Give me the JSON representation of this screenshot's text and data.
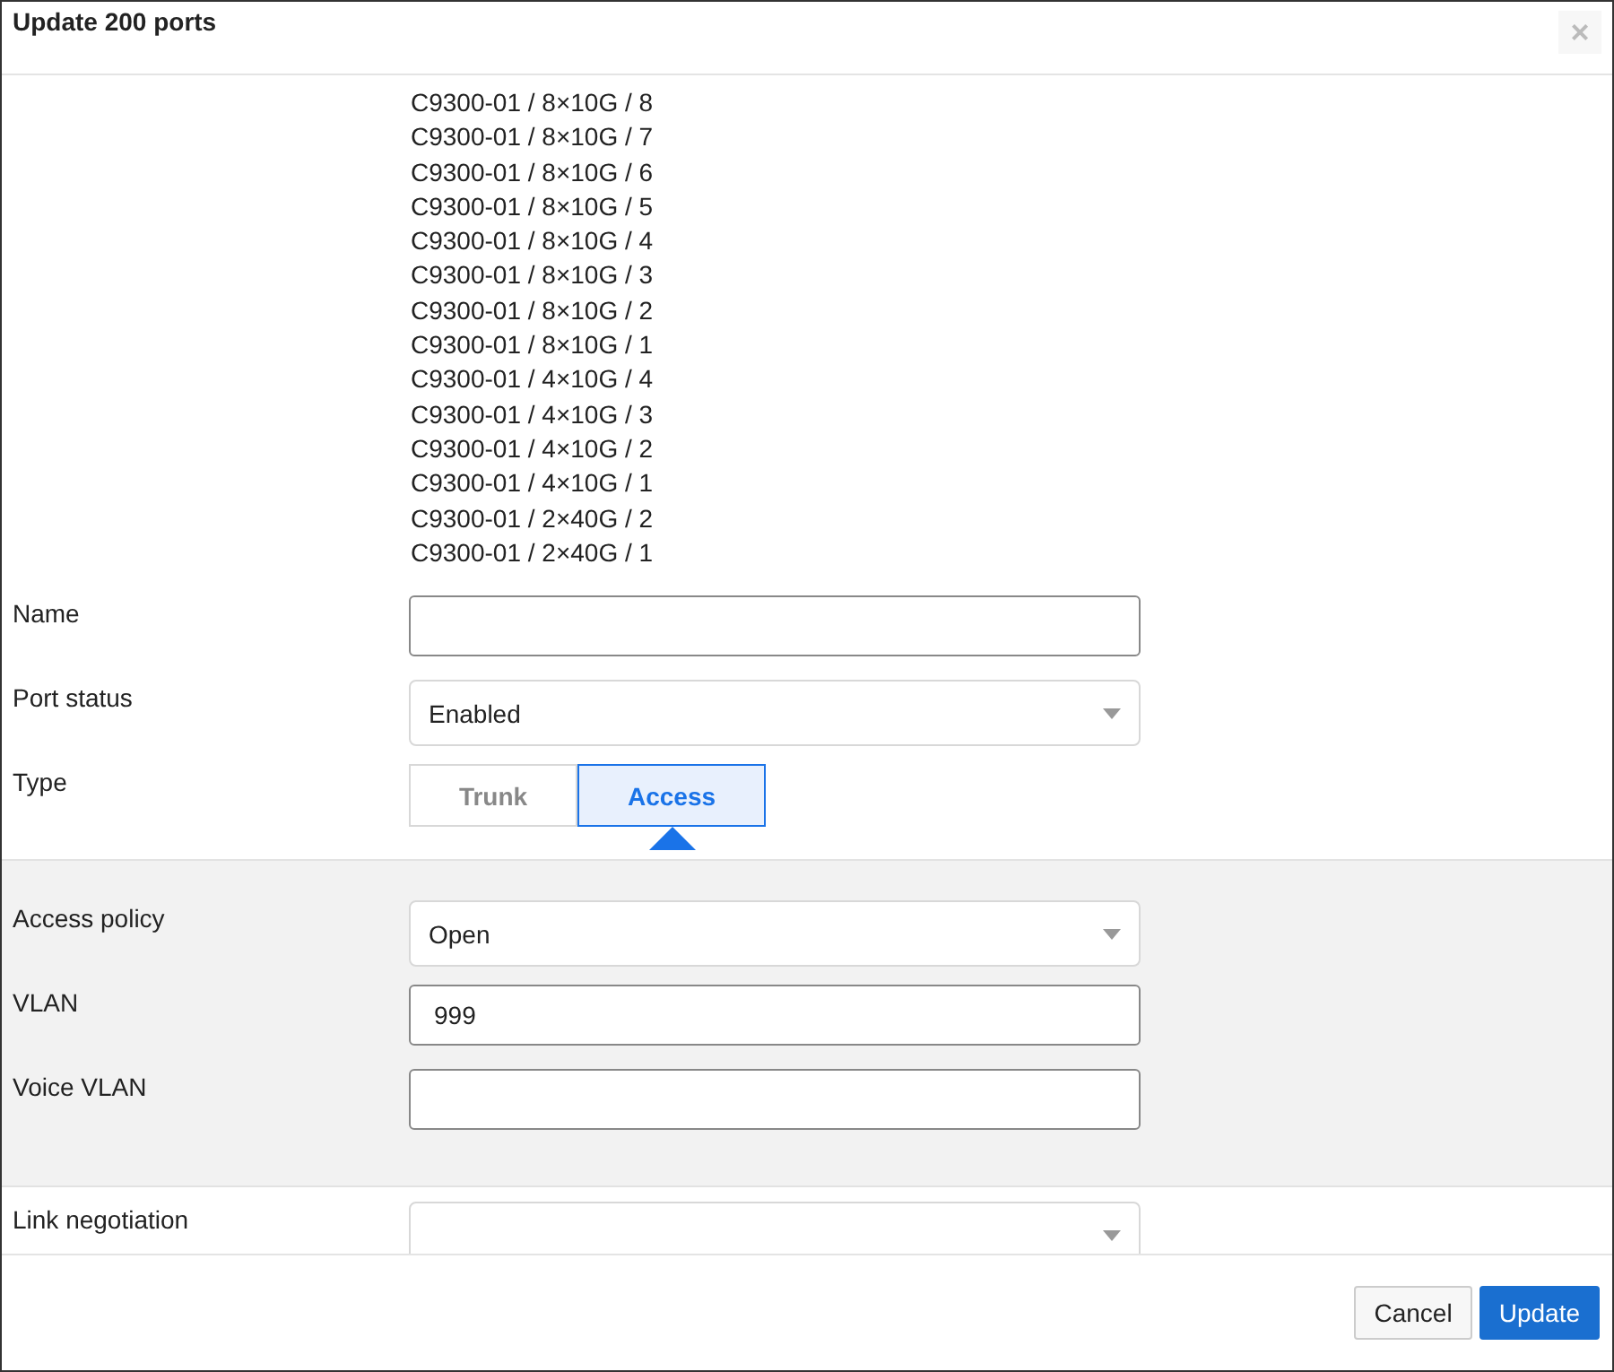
{
  "dialog": {
    "title": "Update 200 ports",
    "close": "×"
  },
  "ports": [
    "C9300-01 / 8×10G / 8",
    "C9300-01 / 8×10G / 7",
    "C9300-01 / 8×10G / 6",
    "C9300-01 / 8×10G / 5",
    "C9300-01 / 8×10G / 4",
    "C9300-01 / 8×10G / 3",
    "C9300-01 / 8×10G / 2",
    "C9300-01 / 8×10G / 1",
    "C9300-01 / 4×10G / 4",
    "C9300-01 / 4×10G / 3",
    "C9300-01 / 4×10G / 2",
    "C9300-01 / 4×10G / 1",
    "C9300-01 / 2×40G / 2",
    "C9300-01 / 2×40G / 1"
  ],
  "fields": [
    {
      "label": "Name",
      "kind": "text"
    },
    {
      "label": "Port status",
      "kind": "select",
      "value": "Enabled"
    },
    {
      "label": "Type",
      "kind": "segmented",
      "options": [
        {
          "label": "Trunk",
          "selected": false
        },
        {
          "label": "Access",
          "selected": true
        }
      ]
    }
  ],
  "access_fields": [
    {
      "label": "Access policy",
      "kind": "select",
      "value": "Open"
    },
    {
      "label": "VLAN",
      "kind": "text",
      "value": "999"
    },
    {
      "label": "Voice VLAN",
      "kind": "text"
    }
  ],
  "more_fields": [
    {
      "label": "Link negotiation",
      "kind": "select"
    }
  ],
  "buttons": [
    {
      "label": "Cancel",
      "kind": "secondary"
    },
    {
      "label": "Update",
      "kind": "primary"
    }
  ]
}
